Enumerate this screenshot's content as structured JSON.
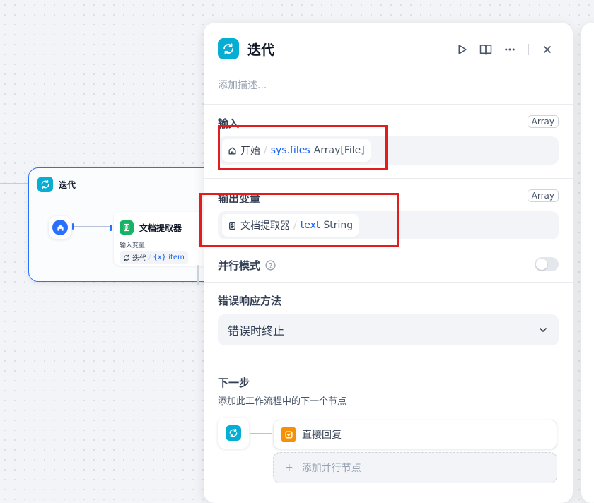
{
  "canvas": {
    "iteration_node": {
      "title": "迭代",
      "child": {
        "title": "文档提取器",
        "input_label": "输入变量",
        "var_source": "迭代",
        "var_sep": "/",
        "var_name": "{x} item"
      }
    }
  },
  "panel": {
    "title": "迭代",
    "description_placeholder": "添加描述...",
    "input": {
      "label": "输入",
      "type_badge": "Array",
      "source": "开始",
      "sep": "/",
      "variable": "sys.files",
      "var_type": "Array[File]"
    },
    "output": {
      "label": "输出变量",
      "type_badge": "Array",
      "source": "文档提取器",
      "sep": "/",
      "variable": "text",
      "var_type": "String"
    },
    "parallel_mode": {
      "label": "并行模式",
      "enabled": false
    },
    "error_handling": {
      "label": "错误响应方法",
      "selected": "错误时终止"
    },
    "next_step": {
      "title": "下一步",
      "description": "添加此工作流程中的下一个节点",
      "node_label": "直接回复",
      "add_parallel_label": "添加并行节点",
      "add_icon": "+"
    }
  },
  "colors": {
    "accent_blue": "#2970ff",
    "iteration_cyan": "#06aed4",
    "doc_green": "#16b364",
    "reply_orange": "#f79009",
    "variable_blue": "#155eef",
    "highlight_red": "#e11d1d"
  },
  "icons": [
    "iteration-icon",
    "play-icon",
    "book-icon",
    "more-icon",
    "close-icon",
    "home-icon",
    "document-icon",
    "help-icon",
    "chevron-down-icon",
    "reply-icon",
    "plus-icon"
  ]
}
